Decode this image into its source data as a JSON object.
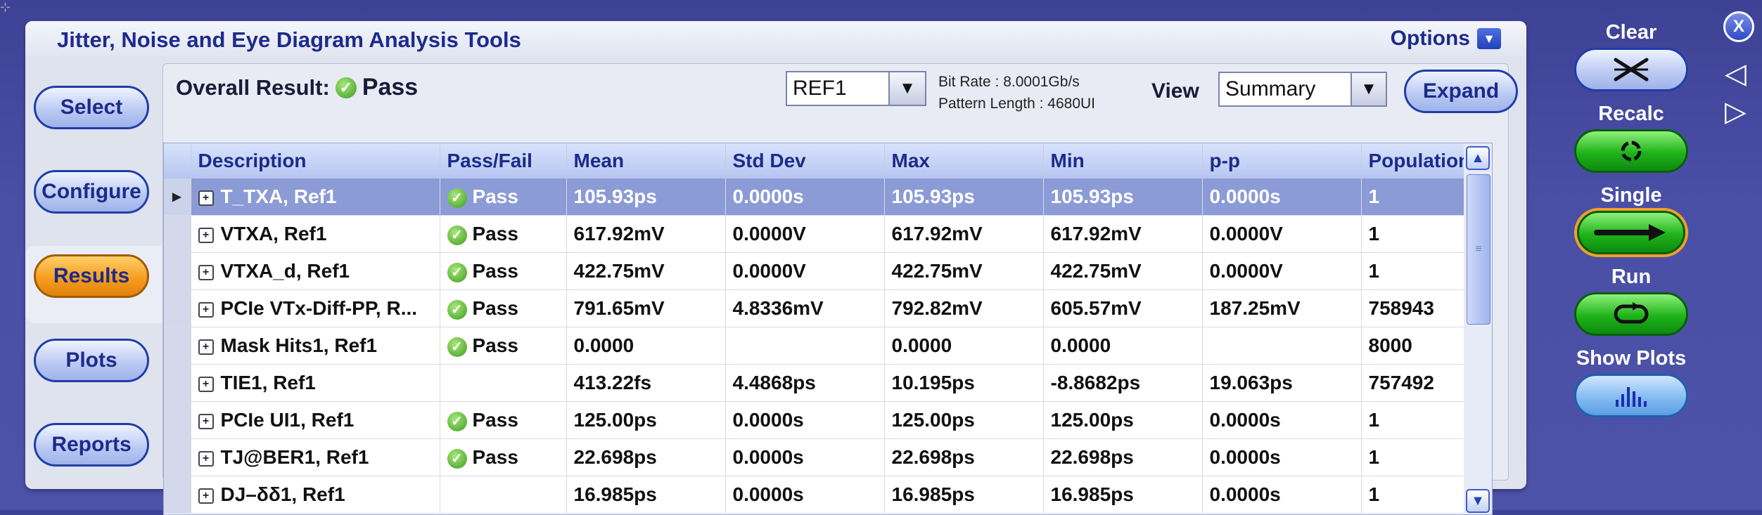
{
  "window": {
    "title": "Jitter, Noise and Eye Diagram Analysis Tools",
    "options_label": "Options",
    "options_dropdown_arrow": "▼"
  },
  "sidebar": {
    "items": [
      {
        "label": "Select",
        "active": false
      },
      {
        "label": "Configure",
        "active": false
      },
      {
        "label": "Results",
        "active": true
      },
      {
        "label": "Plots",
        "active": false
      },
      {
        "label": "Reports",
        "active": false
      }
    ]
  },
  "results": {
    "overall_label": "Overall Result:",
    "overall_value": "Pass",
    "source_value": "REF1",
    "dropdown_arrow": "▼",
    "bit_rate": "Bit Rate : 8.0001Gb/s",
    "pattern_length": "Pattern Length : 4680UI",
    "view_label": "View",
    "view_value": "Summary",
    "expand_label": "Expand"
  },
  "table": {
    "columns": [
      "Description",
      "Pass/Fail",
      "Mean",
      "Std Dev",
      "Max",
      "Min",
      "p-p",
      "Population"
    ],
    "rows": [
      {
        "description": "T_TXA, Ref1",
        "pass_fail": "Pass",
        "mean": "105.93ps",
        "std_dev": "0.0000s",
        "max": "105.93ps",
        "min": "105.93ps",
        "pp": "0.0000s",
        "population": "1",
        "selected": true
      },
      {
        "description": "VTXA, Ref1",
        "pass_fail": "Pass",
        "mean": "617.92mV",
        "std_dev": "0.0000V",
        "max": "617.92mV",
        "min": "617.92mV",
        "pp": "0.0000V",
        "population": "1"
      },
      {
        "description": "VTXA_d, Ref1",
        "pass_fail": "Pass",
        "mean": "422.75mV",
        "std_dev": "0.0000V",
        "max": "422.75mV",
        "min": "422.75mV",
        "pp": "0.0000V",
        "population": "1"
      },
      {
        "description": "PCIe VTx-Diff-PP, R...",
        "pass_fail": "Pass",
        "mean": "791.65mV",
        "std_dev": "4.8336mV",
        "max": "792.82mV",
        "min": "605.57mV",
        "pp": "187.25mV",
        "population": "758943"
      },
      {
        "description": "Mask Hits1, Ref1",
        "pass_fail": "Pass",
        "mean": "0.0000",
        "std_dev": "",
        "max": "0.0000",
        "min": "0.0000",
        "pp": "",
        "population": "8000"
      },
      {
        "description": "TIE1, Ref1",
        "pass_fail": "",
        "mean": "413.22fs",
        "std_dev": "4.4868ps",
        "max": "10.195ps",
        "min": "-8.8682ps",
        "pp": "19.063ps",
        "population": "757492"
      },
      {
        "description": "PCIe UI1, Ref1",
        "pass_fail": "Pass",
        "mean": "125.00ps",
        "std_dev": "0.0000s",
        "max": "125.00ps",
        "min": "125.00ps",
        "pp": "0.0000s",
        "population": "1"
      },
      {
        "description": "TJ@BER1, Ref1",
        "pass_fail": "Pass",
        "mean": "22.698ps",
        "std_dev": "0.0000s",
        "max": "22.698ps",
        "min": "22.698ps",
        "pp": "0.0000s",
        "population": "1"
      },
      {
        "description": "DJ–δδ1, Ref1",
        "pass_fail": "",
        "mean": "16.985ps",
        "std_dev": "0.0000s",
        "max": "16.985ps",
        "min": "16.985ps",
        "pp": "0.0000s",
        "population": "1"
      }
    ]
  },
  "right_panel": {
    "clear_label": "Clear",
    "recalc_label": "Recalc",
    "single_label": "Single",
    "run_label": "Run",
    "show_plots_label": "Show Plots"
  },
  "close_label": "X",
  "colors": {
    "background": "#4a4fa6",
    "accent_blue": "#1f3ea8",
    "active_orange": "#f59a1a",
    "green": "#1fb31a",
    "selected_row": "#8b9bd6"
  }
}
